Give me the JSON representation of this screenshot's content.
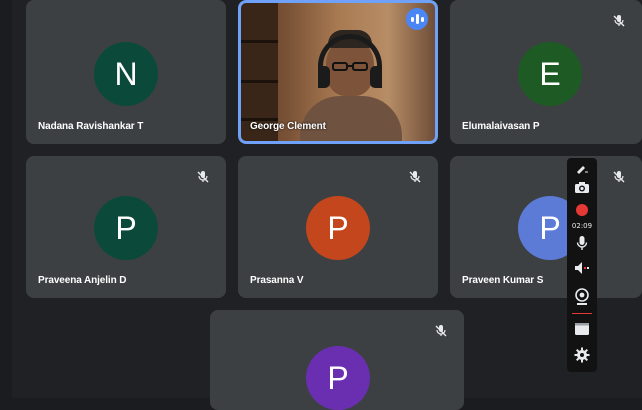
{
  "participants": [
    {
      "name": "Nadana Ravishankar T",
      "initial": "N",
      "color": "#0b4a3a",
      "muted": false
    },
    {
      "name": "George Clement",
      "initial": "",
      "color": "",
      "muted": false,
      "speaking": true,
      "video": true
    },
    {
      "name": "Elumalaivasan P",
      "initial": "E",
      "color": "#1e5b24",
      "muted": true
    },
    {
      "name": "Praveena Anjelin D",
      "initial": "P",
      "color": "#0b4a3a",
      "muted": true
    },
    {
      "name": "Prasanna V",
      "initial": "P",
      "color": "#c4461c",
      "muted": true
    },
    {
      "name": "Praveen Kumar S",
      "initial": "P",
      "color": "#5c7bd6",
      "muted": true
    },
    {
      "name": "",
      "initial": "P",
      "color": "#6a2fb0",
      "muted": true
    }
  ],
  "recorder_toolbar": {
    "timer": "02:09",
    "icons": [
      "pencil-icon",
      "camera-icon",
      "record-stop-icon",
      "microphone-icon",
      "speaker-icon",
      "webcam-icon",
      "screen-icon",
      "gear-icon"
    ],
    "record_color": "#e53935"
  }
}
